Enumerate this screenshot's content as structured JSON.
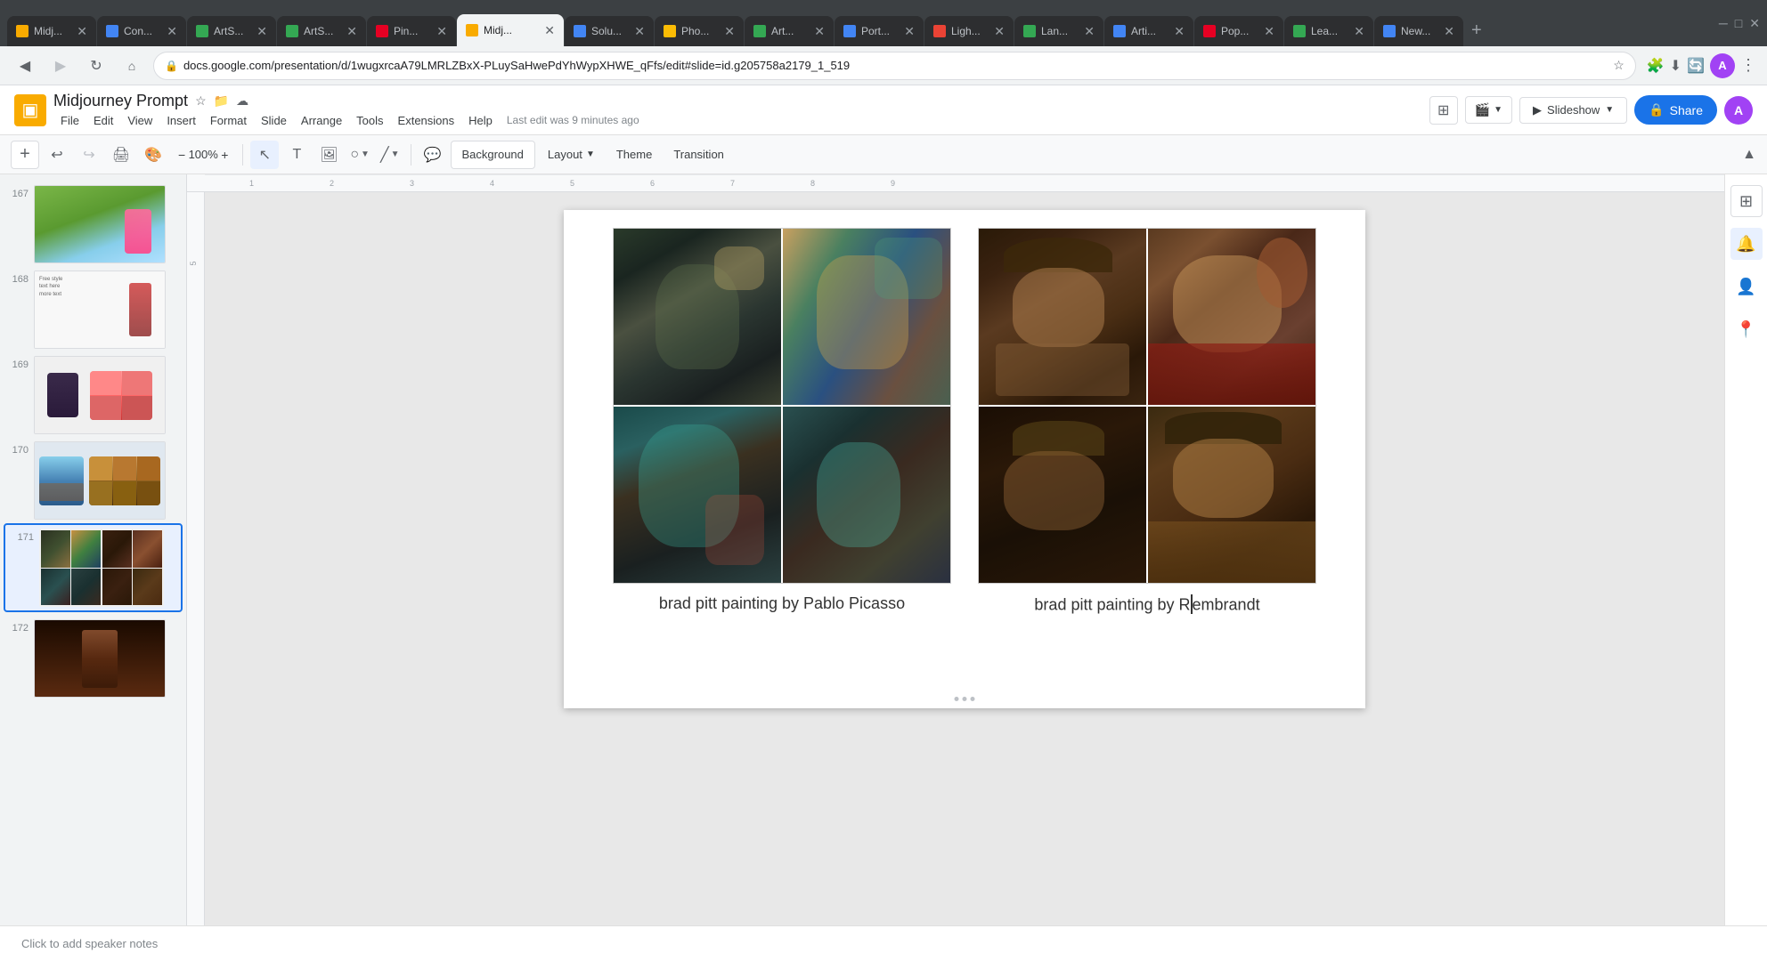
{
  "browser": {
    "tabs": [
      {
        "id": 1,
        "title": "Midj...",
        "favicon_color": "#f9ab00",
        "active": false
      },
      {
        "id": 2,
        "title": "Con...",
        "favicon_color": "#4285f4",
        "active": false
      },
      {
        "id": 3,
        "title": "ArtS...",
        "favicon_color": "#34a853",
        "active": false
      },
      {
        "id": 4,
        "title": "ArtS...",
        "favicon_color": "#34a853",
        "active": false
      },
      {
        "id": 5,
        "title": "Pin...",
        "favicon_color": "#e60023",
        "active": false
      },
      {
        "id": 6,
        "title": "Midj...",
        "favicon_color": "#f9ab00",
        "active": true
      },
      {
        "id": 7,
        "title": "Solu...",
        "favicon_color": "#4285f4",
        "active": false
      },
      {
        "id": 8,
        "title": "Pho...",
        "favicon_color": "#fbbc04",
        "active": false
      },
      {
        "id": 9,
        "title": "Art...",
        "favicon_color": "#34a853",
        "active": false
      },
      {
        "id": 10,
        "title": "Port...",
        "favicon_color": "#4285f4",
        "active": false
      },
      {
        "id": 11,
        "title": "Ligh...",
        "favicon_color": "#ea4335",
        "active": false
      },
      {
        "id": 12,
        "title": "Lan...",
        "favicon_color": "#34a853",
        "active": false
      },
      {
        "id": 13,
        "title": "Arti...",
        "favicon_color": "#4285f4",
        "active": false
      },
      {
        "id": 14,
        "title": "Pop...",
        "favicon_color": "#e60023",
        "active": false
      },
      {
        "id": 15,
        "title": "Lea...",
        "favicon_color": "#34a853",
        "active": false
      },
      {
        "id": 16,
        "title": "New...",
        "favicon_color": "#4285f4",
        "active": false
      }
    ],
    "url": "docs.google.com/presentation/d/1wugxrcaA79LMRLZBxX-PLuySaHwePdYhWypXHWE_qFfs/edit#slide=id.g205758a2179_1_519",
    "profile_initial": "A"
  },
  "app": {
    "title": "Midjourney Prompt",
    "last_edit": "Last edit was 9 minutes ago",
    "menu_items": [
      "File",
      "Edit",
      "View",
      "Insert",
      "Format",
      "Slide",
      "Arrange",
      "Tools",
      "Extensions",
      "Help"
    ]
  },
  "toolbar": {
    "background_label": "Background",
    "layout_label": "Layout",
    "theme_label": "Theme",
    "transition_label": "Transition"
  },
  "slides": [
    {
      "number": "167",
      "active": false
    },
    {
      "number": "168",
      "active": false
    },
    {
      "number": "169",
      "active": false
    },
    {
      "number": "170",
      "active": false
    },
    {
      "number": "171",
      "active": true
    },
    {
      "number": "172",
      "active": false
    }
  ],
  "slide_content": {
    "left_caption": "brad pitt painting by Pablo Picasso",
    "right_caption": "brad pitt painting by Rembrandt"
  },
  "speaker_notes": {
    "placeholder": "Click to add speaker notes"
  },
  "sidebar_right": {
    "icons": [
      "⊞",
      "🔔",
      "👤",
      "📍"
    ]
  }
}
